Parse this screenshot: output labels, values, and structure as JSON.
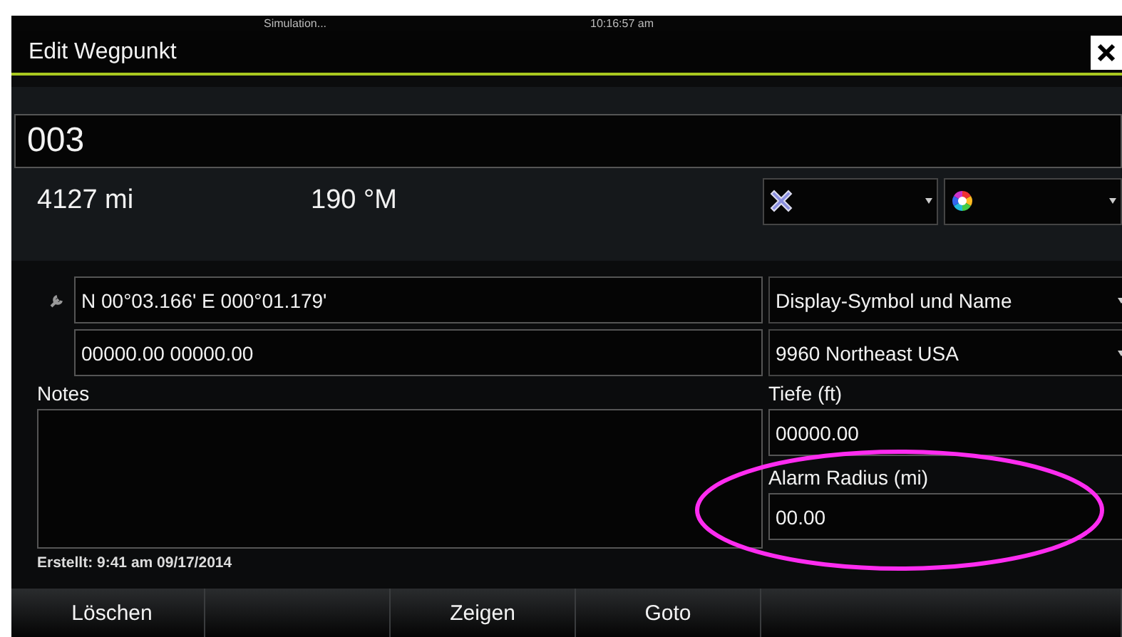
{
  "status_bar": {
    "source": "Simulation...",
    "time": "10:16:57 am"
  },
  "window": {
    "title": "Edit Wegpunkt"
  },
  "waypoint": {
    "name": "003",
    "distance": "4127 mi",
    "bearing": "190 °M"
  },
  "position": {
    "primary": "N 00°03.166'   E 000°01.179'",
    "secondary": "00000.00  00000.00"
  },
  "display_dropdown": "Display-Symbol und Name",
  "chart_dropdown": "9960 Northeast USA",
  "notes": {
    "label": "Notes"
  },
  "depth": {
    "label": "Tiefe (ft)",
    "value": "00000.00"
  },
  "alarm": {
    "label": "Alarm Radius (mi)",
    "value": "00.00",
    "highlighted": true
  },
  "created": "Erstellt: 9:41 am  09/17/2014",
  "soft_keys": [
    {
      "kind": "key",
      "label": "Löschen"
    },
    {
      "kind": "blank"
    },
    {
      "kind": "key",
      "label": "Zeigen"
    },
    {
      "kind": "key",
      "label": "Goto"
    },
    {
      "kind": "blank"
    }
  ]
}
